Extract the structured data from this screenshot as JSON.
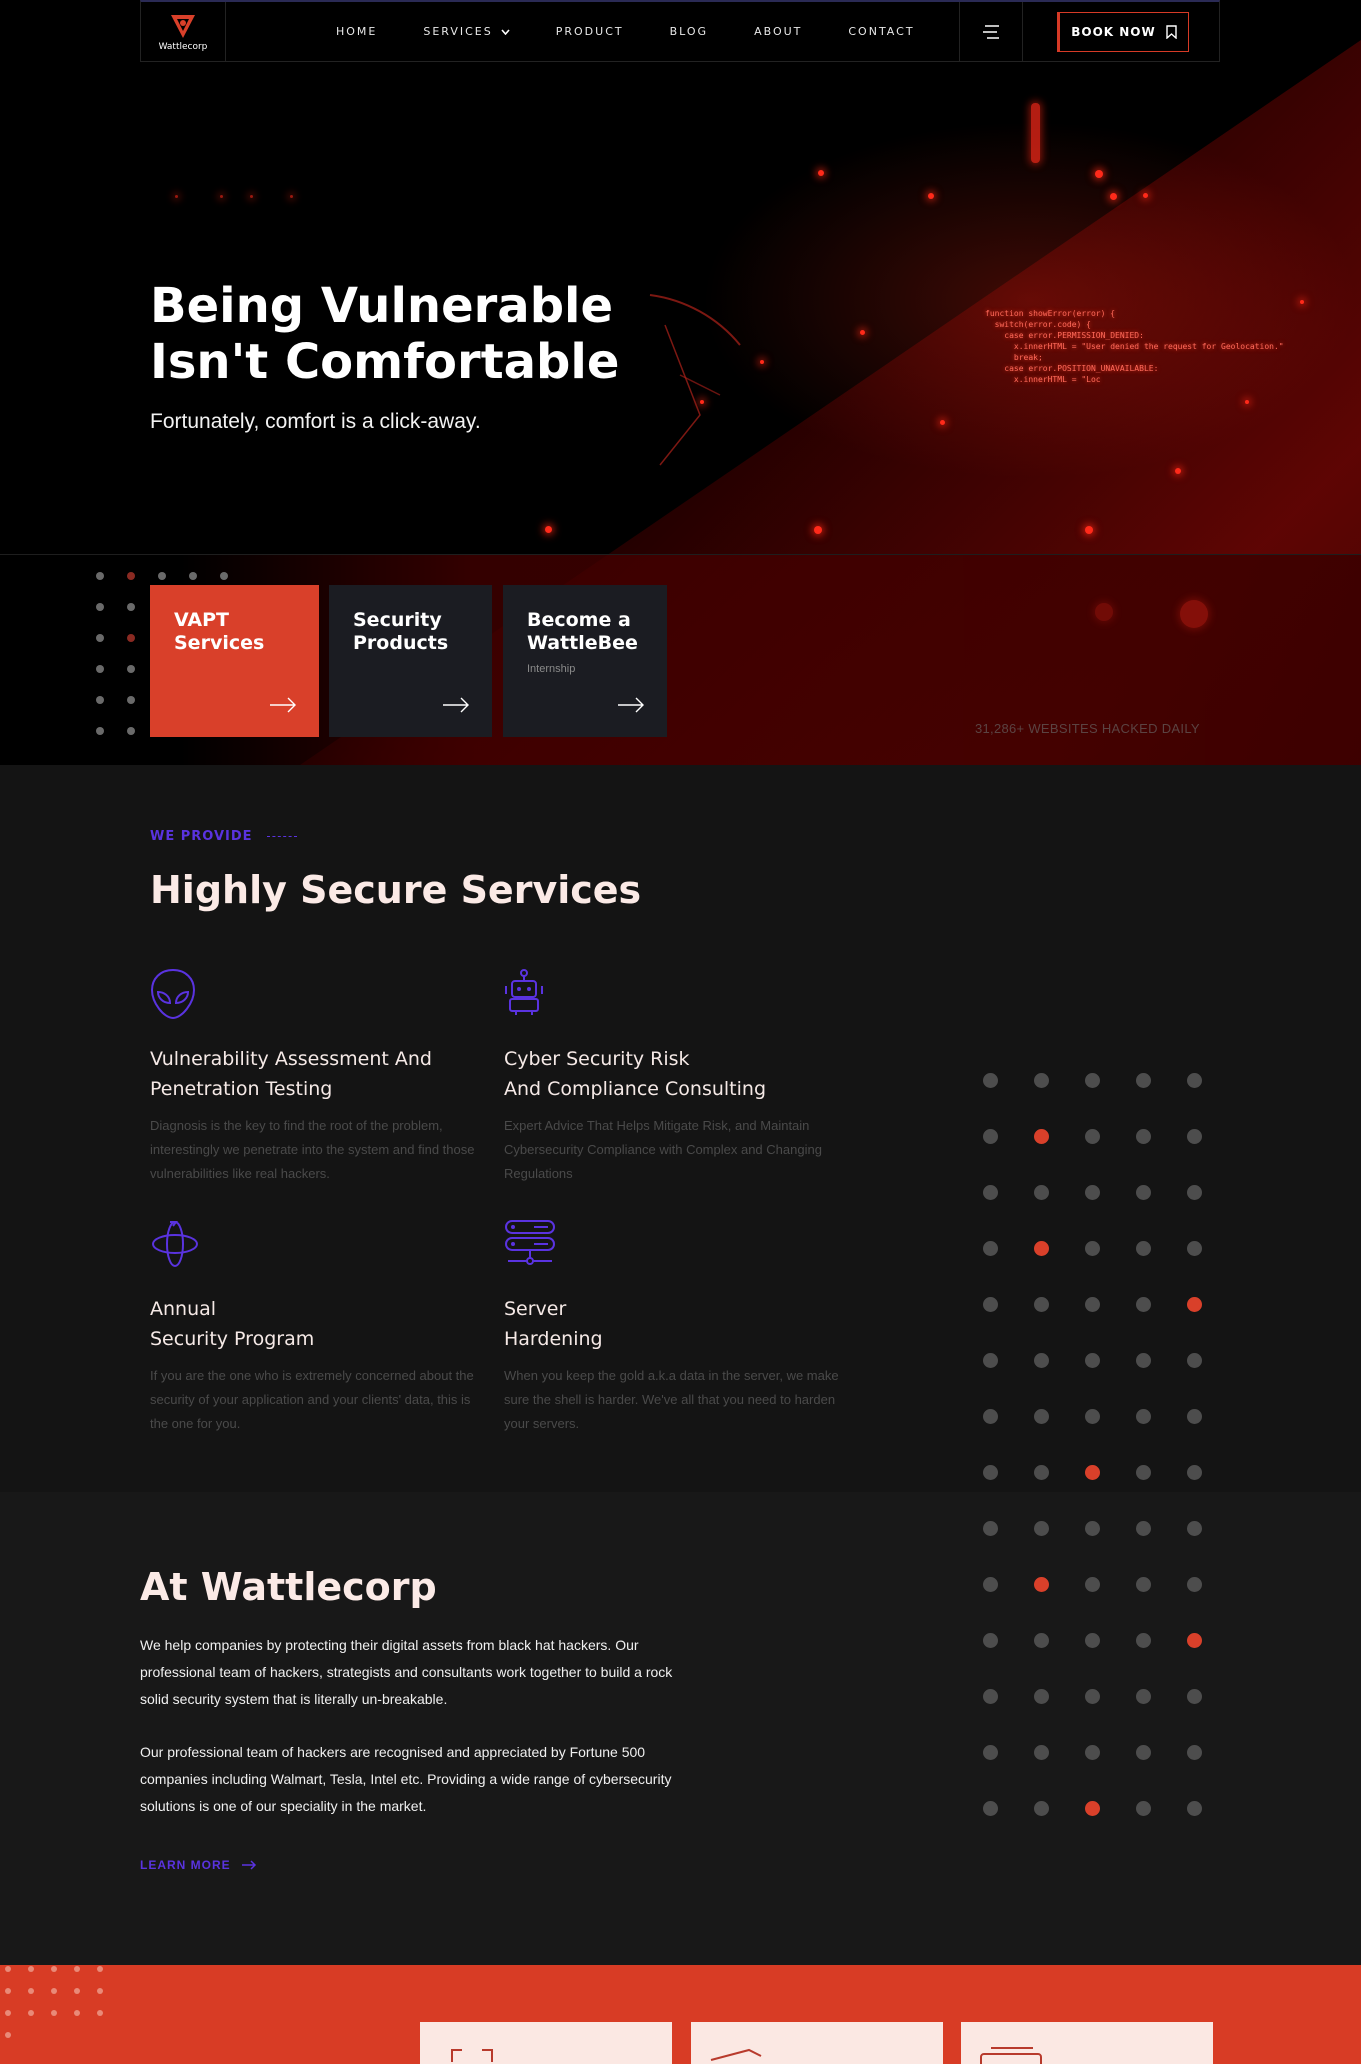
{
  "nav": {
    "logo_text": "Wattlecorp",
    "links": [
      "HOME",
      "SERVICES",
      "PRODUCT",
      "BLOG",
      "ABOUT",
      "CONTACT"
    ],
    "book_label": "BOOK NOW"
  },
  "hero": {
    "title_line1": "Being Vulnerable",
    "title_line2": "Isn't Comfortable",
    "subtitle": "Fortunately, comfort is a click-away.",
    "code": "function showError(error) {\n  switch(error.code) {\n    case error.PERMISSION_DENIED:\n      x.innerHTML = \"User denied the request for Geolocation.\"\n      break;\n    case error.POSITION_UNAVAILABLE:\n      x.innerHTML = \"Loc"
  },
  "cards": [
    {
      "line1": "VAPT",
      "line2": "Services",
      "sub": ""
    },
    {
      "line1": "Security",
      "line2": "Products",
      "sub": ""
    },
    {
      "line1": "Become a",
      "line2": "WattleBee",
      "sub": "Internship"
    }
  ],
  "hacked_text": "31,286+ WEBSITES HACKED DAILY",
  "services": {
    "eyebrow": "WE PROVIDE",
    "title": "Highly Secure Services",
    "items": [
      {
        "title1": "Vulnerability Assessment And",
        "title2": "Penetration Testing",
        "desc": "Diagnosis is the key to find the root of the problem, interestingly we penetrate into the system and find those vulnerabilities like real hackers.",
        "icon": "alien-icon"
      },
      {
        "title1": "Cyber Security Risk",
        "title2": "And Compliance Consulting",
        "desc": "Expert Advice That Helps Mitigate Risk, and Maintain Cybersecurity Compliance with Complex and Changing Regulations",
        "icon": "robot-icon"
      },
      {
        "title1": "Annual",
        "title2": "Security Program",
        "desc": "If you are the one who is extremely concerned about the security of your application and your clients' data, this is the one for you.",
        "icon": "orbit-icon"
      },
      {
        "title1": "Server",
        "title2": "Hardening",
        "desc": "When you keep the gold a.k.a data in the server, we make sure the shell is harder. We've all that you need to harden your servers.",
        "icon": "server-icon"
      }
    ]
  },
  "about": {
    "title": "At Wattlecorp",
    "p1": "We help companies by protecting their digital assets from black hat hackers. Our professional team of hackers, strategists and consultants work together to build a rock solid security system that is literally un-breakable.",
    "p2": "Our professional team of hackers are recognised and appreciated by Fortune 500 companies including Walmart, Tesla, Intel etc. Providing a wide range of cybersecurity solutions is one of our speciality in the market.",
    "learn_more": "LEARN MORE"
  },
  "colors": {
    "accent": "#d9402a",
    "purple": "#5a33e0",
    "dark": "#141414"
  }
}
